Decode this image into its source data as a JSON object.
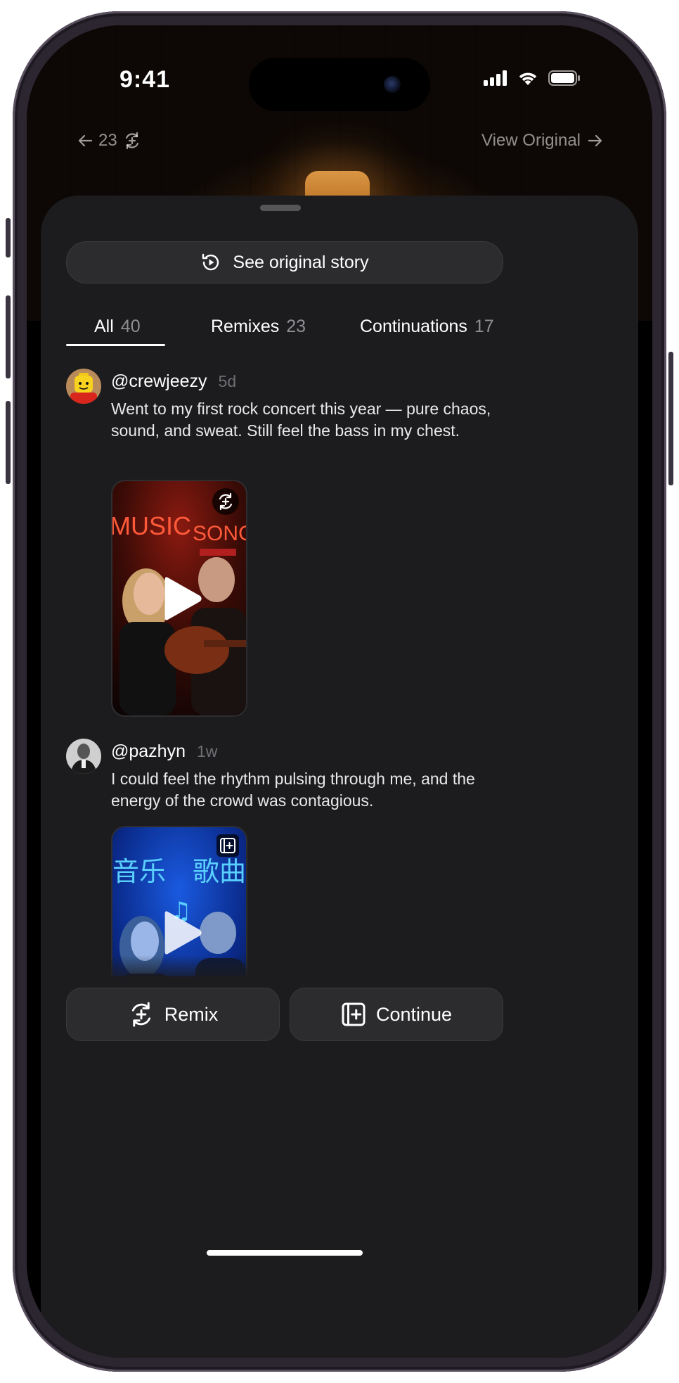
{
  "status_bar": {
    "time": "9:41"
  },
  "nav": {
    "back_count": "23",
    "view_original": "View Original"
  },
  "sheet": {
    "see_original_label": "See original story",
    "tabs": [
      {
        "label": "All",
        "count": "40",
        "active": true
      },
      {
        "label": "Remixes",
        "count": "23",
        "active": false
      },
      {
        "label": "Continuations",
        "count": "17",
        "active": false
      }
    ],
    "posts": [
      {
        "handle": "@crewjeezy",
        "age": "5d",
        "text": "Went to my first rock concert this year — pure chaos, sound, and sweat. Still feel the bass in my chest.",
        "thumb_sign_left": "MUSIC",
        "thumb_sign_right": "SONGS",
        "badge_icon": "remix-icon"
      },
      {
        "handle": "@pazhyn",
        "age": "1w",
        "text": "I could feel the rhythm pulsing through me, and the energy of the crowd was contagious.",
        "thumb_sign_left": "音乐",
        "thumb_sign_right": "歌曲",
        "badge_icon": "continue-icon"
      }
    ]
  },
  "actions": {
    "remix_label": "Remix",
    "continue_label": "Continue"
  },
  "colors": {
    "sheet_bg": "#1c1c1e",
    "button_bg": "#2c2c2e",
    "muted_text": "#8e8e93"
  }
}
